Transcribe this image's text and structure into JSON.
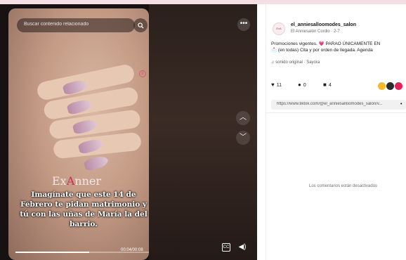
{
  "search": {
    "placeholder": "Buscar contenido relacionado"
  },
  "video": {
    "brand_prefix": "Ex",
    "brand_accent": "A",
    "brand_suffix": "nner",
    "caption": "Imagínate que este 14 de Febrero te pidan matrimonio y tú con las uñas de María la del barrio.",
    "time": "00:04/00:08",
    "progress_fraction": 0.55,
    "cc_label": "CC"
  },
  "icons": {
    "search": "search-icon",
    "more": "more-options-icon",
    "up": "chevron-up-icon",
    "down": "chevron-down-icon",
    "volume": "volume-icon",
    "captions": "captions-icon"
  },
  "creator": {
    "avatar_text": "ExA",
    "username": "el_anniesalloomodes_salon",
    "subline": "El Anniesalón Cordio · 2-7"
  },
  "post": {
    "description_line1": "Promociones vigentes. 💗 PARAO ÚNICAMENTE EN",
    "description_line2": "📩 (en todas) Cita y por orden de llegada. Agenda",
    "music": "♫ sonido original · Sayora"
  },
  "actions": [
    {
      "icon": "heart-icon",
      "glyph": "♥",
      "count": "11"
    },
    {
      "icon": "comment-icon",
      "glyph": "●",
      "count": "0"
    },
    {
      "icon": "bookmark-icon",
      "glyph": "■",
      "count": "4"
    }
  ],
  "link": {
    "url": "https://www.tiktok.com/@el_anniesalloomodes_salon/v...",
    "copy_label": "•"
  },
  "comments": {
    "disabled_text": "Los comentarios están desactivados"
  },
  "colors": {
    "accent": "#c62f58",
    "share1": "#f5b82e",
    "share2": "#2b2b2b",
    "share3": "#e0245e"
  }
}
